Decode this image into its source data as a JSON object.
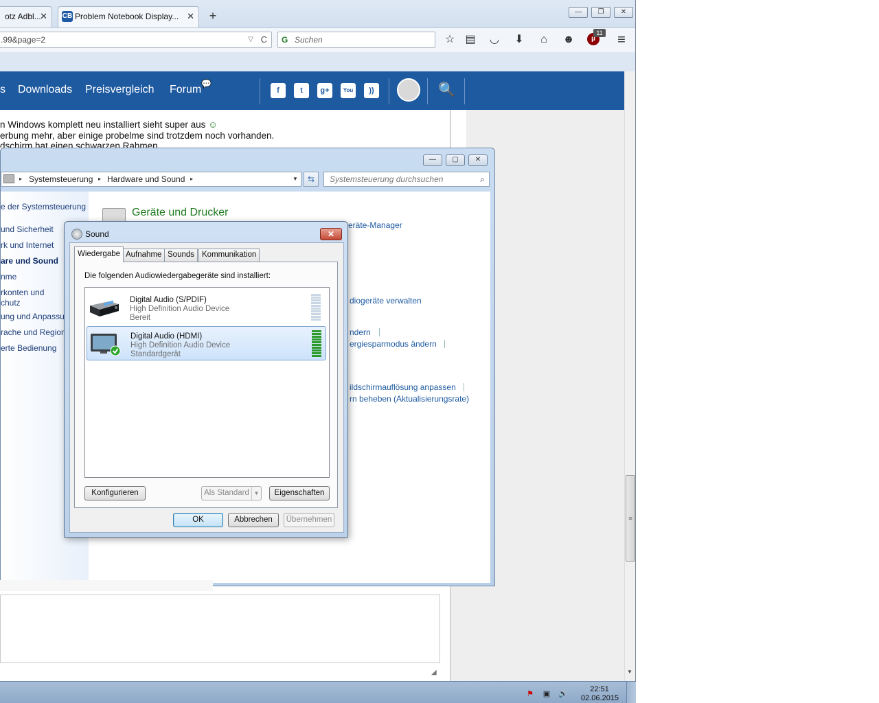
{
  "browser": {
    "tabs": [
      {
        "label": "otz Adbl...",
        "active": false
      },
      {
        "label": "Problem Notebook Display...",
        "active": true
      }
    ],
    "favicon_text": "CB",
    "close_glyph": "✕",
    "newtab_glyph": "+",
    "window_buttons": {
      "minimize": "—",
      "restore": "❐",
      "close": "✕"
    },
    "url": ".99&page=2",
    "url_dropdown_glyph": "▽",
    "reload_glyph": "C",
    "search_placeholder": "Suchen",
    "search_engine_glyph": "G",
    "ublock_badge": "11",
    "ublock_glyph": "µ",
    "toolbar_icons": [
      "star-icon",
      "reading-list-icon",
      "pocket-icon",
      "download-icon",
      "home-icon",
      "chat-icon",
      "ublock-icon",
      "menu-icon"
    ],
    "toolbar_glyphs": {
      "star": "☆",
      "reading": "▤",
      "pocket": "◡",
      "download": "⬇",
      "home": "⌂",
      "chat": "☻",
      "menu": "≡"
    }
  },
  "site": {
    "nav": {
      "partial": "s",
      "downloads": "Downloads",
      "preisvergleich": "Preisvergleich",
      "forum": "Forum",
      "forum_badge": "💬"
    },
    "social_glyphs": {
      "facebook": "f",
      "twitter": "t",
      "googleplus": "g+",
      "youtube": "You",
      "rss": "))"
    },
    "search_glyph": "🔍",
    "accent_color": "#1e5aa0",
    "post_lines": [
      "n Windows komplett neu installiert sieht super aus",
      "erbung mehr, aber einige probelme sind trotzdem noch vorhanden.",
      "dschirm hat einen schwarzen Rahmen"
    ],
    "smiley_glyph": "☺",
    "resize_glyph": "◢",
    "scroll_grip_glyph": "≡",
    "scroll_down_glyph": "▼"
  },
  "control_panel": {
    "window_buttons": {
      "minimize": "—",
      "maximize": "▢",
      "close": "✕"
    },
    "breadcrumb": [
      "Systemsteuerung",
      "Hardware und Sound"
    ],
    "breadcrumb_sep_glyph": "▸",
    "breadcrumb_dropdown_glyph": "▼",
    "refresh_glyph": "⇆",
    "search_placeholder": "Systemsteuerung durchsuchen",
    "search_glyph": "⌕",
    "left_nav": [
      {
        "label": "e der Systemsteuerung",
        "bold": false
      },
      {
        "label": "und Sicherheit",
        "bold": false
      },
      {
        "label": "rk und Internet",
        "bold": false
      },
      {
        "label": "are und Sound",
        "bold": true
      },
      {
        "label": "nme",
        "bold": false
      },
      {
        "label": "rkonten und",
        "bold": false
      },
      {
        "label": "chutz",
        "bold": false
      },
      {
        "label": "ung und Anpassung",
        "bold": false
      },
      {
        "label": "rache und Region",
        "bold": false
      },
      {
        "label": "erte Bedienung",
        "bold": false
      }
    ],
    "section_title": "Geräte und Drucker",
    "links": [
      "eräte-Manager",
      "diogeräte verwalten",
      "ndern",
      "ergiesparmodus ändern",
      "ildschirmauflösung anpassen",
      "rn beheben (Aktualisierungsrate)"
    ]
  },
  "sound_dialog": {
    "title": "Sound",
    "close_glyph": "✕",
    "tabs": [
      "Wiedergabe",
      "Aufnahme",
      "Sounds",
      "Kommunikation"
    ],
    "active_tab": "Wiedergabe",
    "intro": "Die folgenden Audiowiedergabegeräte sind installiert:",
    "devices": [
      {
        "name": "Digital Audio (S/PDIF)",
        "description": "High Definition Audio Device",
        "status": "Bereit",
        "selected": false,
        "is_default": false,
        "level": 0
      },
      {
        "name": "Digital Audio (HDMI)",
        "description": "High Definition Audio Device",
        "status": "Standardgerät",
        "selected": true,
        "is_default": true,
        "level": 1
      }
    ],
    "default_check_glyph": "✔",
    "buttons": {
      "configure": "Konfigurieren",
      "set_default": "Als Standard",
      "set_default_dropdown_glyph": "▼",
      "properties": "Eigenschaften",
      "ok": "OK",
      "cancel": "Abbrechen",
      "apply": "Übernehmen"
    },
    "meter_active_color": "#2a9a2a",
    "meter_idle_color": "#c9d6e3"
  },
  "taskbar": {
    "time": "22:51",
    "date": "02.06.2015",
    "tray_glyphs": {
      "flag": "⚑",
      "network": "▣",
      "volume": "🔊"
    }
  }
}
